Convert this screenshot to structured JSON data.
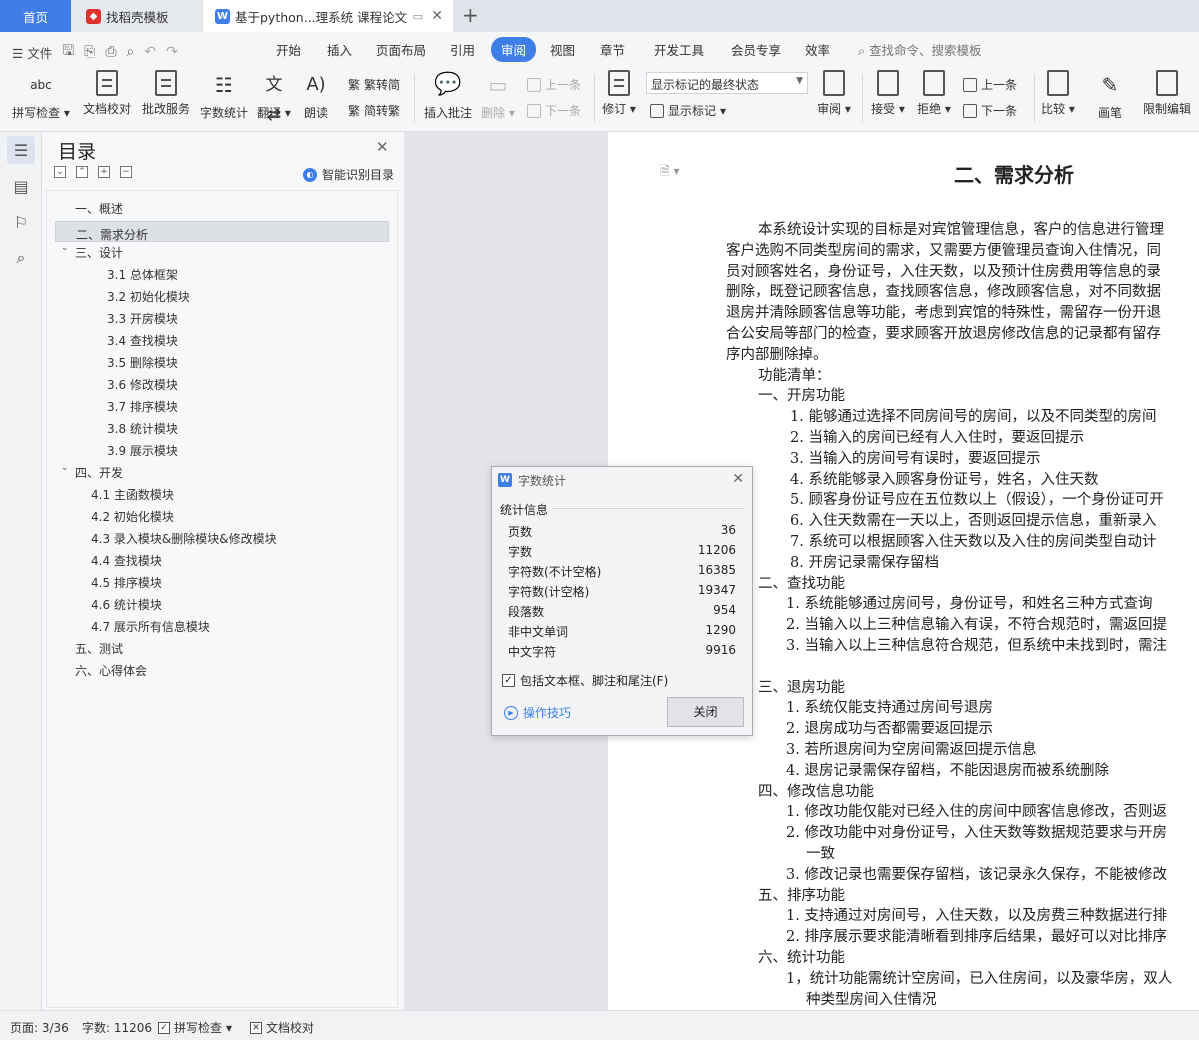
{
  "tabs": [
    {
      "label": "首页"
    },
    {
      "label": "找稻壳模板"
    },
    {
      "label": "基于python...理系统 课程论文"
    }
  ],
  "menu": {
    "file": "文件",
    "items": [
      "开始",
      "插入",
      "页面布局",
      "引用",
      "审阅",
      "视图",
      "章节",
      "开发工具",
      "会员专享",
      "效率"
    ],
    "active": "审阅",
    "search_placeholder": "查找命令、搜索模板"
  },
  "ribbon": {
    "spell_check": "拼写检查",
    "doc_proof": "文档校对",
    "batch_service": "批改服务",
    "word_count": "字数统计",
    "translate": "翻译",
    "read_aloud": "朗读",
    "trad_convert": "繁转简",
    "simp_convert": "简转繁",
    "insert_comment": "插入批注",
    "delete": "删除",
    "prev": "上一条",
    "next": "下一条",
    "track": "修订",
    "markup_select": "显示标记的最终状态",
    "show_markup": "显示标记",
    "review": "审阅",
    "accept": "接受",
    "reject": "拒绝",
    "prev2": "上一条",
    "next2": "下一条",
    "compare": "比较",
    "pen": "画笔",
    "restrict": "限制编辑"
  },
  "toc": {
    "title": "目录",
    "smart": "智能识别目录",
    "items": [
      {
        "label": "一、概述"
      },
      {
        "label": "二、需求分析"
      },
      {
        "label": "三、设计"
      },
      {
        "label": "3.1 总体框架"
      },
      {
        "label": "3.2 初始化模块"
      },
      {
        "label": "3.3 开房模块"
      },
      {
        "label": "3.4 查找模块"
      },
      {
        "label": "3.5 删除模块"
      },
      {
        "label": "3.6 修改模块"
      },
      {
        "label": "3.7 排序模块"
      },
      {
        "label": "3.8 统计模块"
      },
      {
        "label": "3.9 展示模块"
      },
      {
        "label": "四、开发"
      },
      {
        "label": "4.1 主函数模块"
      },
      {
        "label": "4.2 初始化模块"
      },
      {
        "label": "4.3 录入模块&删除模块&修改模块"
      },
      {
        "label": "4.4 查找模块"
      },
      {
        "label": "4.5 排序模块"
      },
      {
        "label": "4.6 统计模块"
      },
      {
        "label": "4.7 展示所有信息模块"
      },
      {
        "label": "五、测试"
      },
      {
        "label": "六、心得体会"
      }
    ]
  },
  "doc": {
    "heading": "二、需求分析",
    "lines": [
      "本系统设计实现的目标是对宾馆管理信息，客户的信息进行管理",
      "客户选购不同类型房间的需求，又需要方便管理员查询入住情况，同",
      "员对顾客姓名，身份证号，入住天数，以及预计住房费用等信息的录",
      "删除，既登记顾客信息，查找顾客信息，修改顾客信息，对不同数据",
      "退房并清除顾客信息等功能，考虑到宾馆的特殊性，需留存一份开退",
      "合公安局等部门的检查，要求顾客开放退房修改信息的记录都有留存",
      "序内部删除掉。",
      "功能清单：",
      "一、开房功能",
      "1.  能够通过选择不同房间号的房间，以及不同类型的房间",
      "2.  当输入的房间已经有人入住时，要返回提示",
      "3.  当输入的房间号有误时，要返回提示",
      "4.  系统能够录入顾客身份证号，姓名，入住天数",
      "5.  顾客身份证号应在五位数以上（假设），一个身份证可开",
      "6.  入住天数需在一天以上，否则返回提示信息，重新录入",
      "7.  系统可以根据顾客入住天数以及入住的房间类型自动计",
      "8.  开房记录需保存留档",
      "二、查找功能",
      "1.  系统能够通过房间号，身份证号，和姓名三种方式查询",
      "2.  当输入以上三种信息输入有误，不符合规范时，需返回提",
      "3.  当输入以上三种信息符合规范，但系统中未找到时，需注",
      "三、退房功能",
      "1.  系统仅能支持通过房间号退房",
      "2.  退房成功与否都需要返回提示",
      "3.  若所退房间为空房间需返回提示信息",
      "4.  退房记录需保存留档，不能因退房而被系统删除",
      "四、修改信息功能",
      "1.  修改功能仅能对已经入住的房间中顾客信息修改，否则返",
      "2.  修改功能中对身份证号，入住天数等数据规范要求与开房",
      "一致",
      "3.  修改记录也需要保存留档，该记录永久保存，不能被修改",
      "五、排序功能",
      "1.  支持通过对房间号，入住天数，以及房费三种数据进行排",
      "2.  排序展示要求能清晰看到排序后结果，最好可以对比排序",
      "六、统计功能",
      "1，统计功能需统计空房间，已入住房间，以及豪华房，双人",
      "种类型房间入住情况"
    ]
  },
  "dialog": {
    "title": "字数统计",
    "section": "统计信息",
    "stats": [
      {
        "label": "页数",
        "value": "36"
      },
      {
        "label": "字数",
        "value": "11206"
      },
      {
        "label": "字符数(不计空格)",
        "value": "16385"
      },
      {
        "label": "字符数(计空格)",
        "value": "19347"
      },
      {
        "label": "段落数",
        "value": "954"
      },
      {
        "label": "非中文单词",
        "value": "1290"
      },
      {
        "label": "中文字符",
        "value": "9916"
      }
    ],
    "checkbox_label": "包括文本框、脚注和尾注(F)",
    "checkbox_checked": true,
    "tips": "操作技巧",
    "close": "关闭"
  },
  "status": {
    "page": "页面: 3/36",
    "words": "字数: 11206",
    "spell": "拼写检查",
    "proof": "文档校对"
  },
  "colors": {
    "accent": "#3f7ee8",
    "tab_bar": "#dfe3ea",
    "wps_red": "#e0312f"
  }
}
